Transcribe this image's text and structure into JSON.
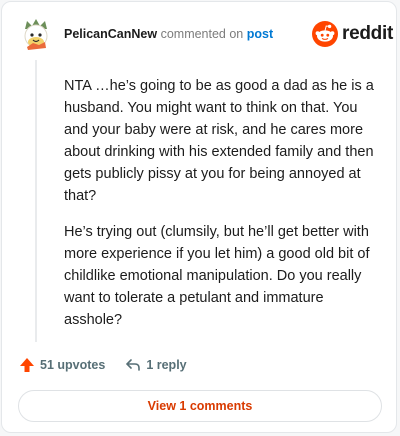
{
  "comment": {
    "username": "PelicanCanNew",
    "action_text": "commented on",
    "target_text": "post",
    "body": [
      "NTA …he’s going to be as good a dad as he is a husband. You might want to think on that. You and your baby were at risk, and he cares more about drinking with his extended family and then gets publicly pissy at you for being annoyed at that?",
      "He’s trying out (clumsily, but he’ll get better with more experience if you let him) a good old bit of childlike emotional manipulation. Do you really want to tolerate a petulant and immature asshole?"
    ]
  },
  "brand": {
    "name": "reddit",
    "icon": "reddit-snoo-icon",
    "color": "#ff4500"
  },
  "actions": {
    "upvotes_label": "51 upvotes",
    "upvote_icon": "upvote-arrow-icon",
    "replies_label": "1 reply",
    "reply_icon": "reply-arrow-icon"
  },
  "view_comments_label": "View 1 comments",
  "colors": {
    "accent": "#d93a00",
    "link": "#0079d3",
    "upvote": "#ff4500",
    "text": "#1c1c1c",
    "muted": "#576f76"
  }
}
